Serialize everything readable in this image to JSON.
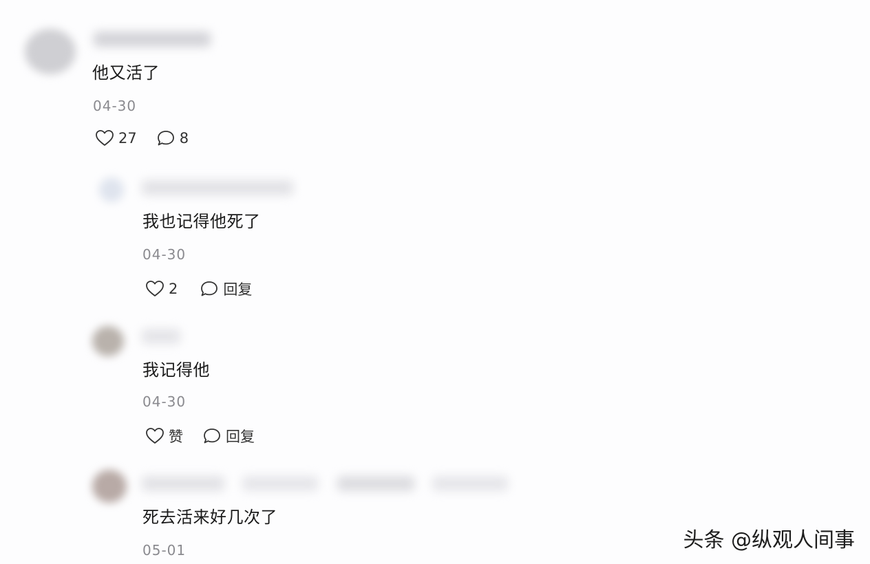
{
  "comments": [
    {
      "text": "他又活了",
      "date": "04-30",
      "likes": "27",
      "replies": "8"
    },
    {
      "text": "我也记得他死了",
      "date": "04-30",
      "likes": "2",
      "reply_label": "回复"
    },
    {
      "text": "我记得他",
      "date": "04-30",
      "like_label": "赞",
      "reply_label": "回复"
    },
    {
      "text": "死去活来好几次了",
      "date": "05-01"
    }
  ],
  "icons": {
    "like": "heart-icon",
    "reply": "speech-bubble-icon"
  },
  "watermark": "头条 @纵观人间事"
}
